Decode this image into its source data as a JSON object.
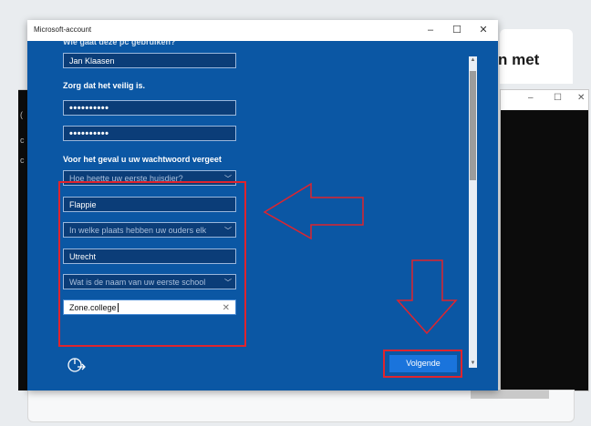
{
  "background": {
    "partial_heading": "n met"
  },
  "dialog": {
    "title": "Microsoft-account",
    "controls": {
      "minimize": "–",
      "maximize": "☐",
      "close": "✕"
    },
    "cut_label": "Wie gaat deze pc gebruiken?",
    "name_value": "Jan Klaasen",
    "secure_label": "Zorg dat het veilig is.",
    "password_value": "••••••••••",
    "confirm_value": "••••••••••",
    "forgot_label": "Voor het geval u uw wachtwoord vergeet",
    "questions": [
      {
        "question": "Hoe heette uw eerste huisdier?",
        "answer": "Flappie"
      },
      {
        "question": "In welke plaats hebben uw ouders elk",
        "answer": "Utrecht"
      },
      {
        "question": "Wat is de naam van uw eerste school",
        "answer": "Zone.college"
      }
    ],
    "next_label": "Volgende",
    "accessibility_icon": "accessibility-icon"
  },
  "colors": {
    "dialog_bg": "#0b57a4",
    "field_bg": "#0b3d78",
    "highlight": "#e0242d",
    "button": "#1a74dc"
  }
}
